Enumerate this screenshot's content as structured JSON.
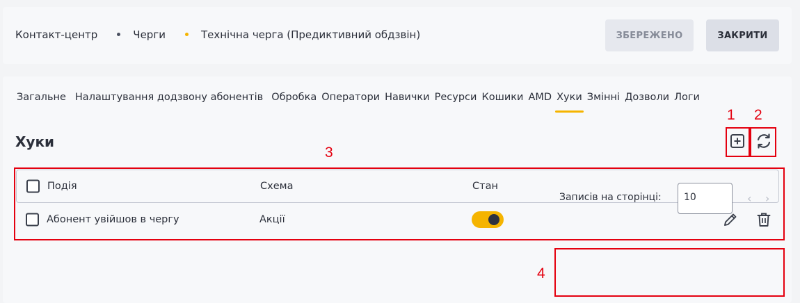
{
  "breadcrumb": [
    {
      "label": "Контакт-центр"
    },
    {
      "label": "Черги",
      "dot_color": "#4a5060"
    },
    {
      "label": "Технічна черга (Предиктивний обдзвін)",
      "dot_color": "#f5b400"
    }
  ],
  "header": {
    "saved_label": "ЗБЕРЕЖЕНО",
    "close_label": "ЗАКРИТИ"
  },
  "tabs": [
    {
      "label": "Загальне"
    },
    {
      "label": "Налаштування додзвону абонентів"
    },
    {
      "label": "Обробка"
    },
    {
      "label": "Оператори"
    },
    {
      "label": "Навички"
    },
    {
      "label": "Ресурси"
    },
    {
      "label": "Кошики"
    },
    {
      "label": "AMD"
    },
    {
      "label": "Хуки",
      "active": true
    },
    {
      "label": "Змінні"
    },
    {
      "label": "Дозволи"
    },
    {
      "label": "Логи"
    }
  ],
  "section": {
    "title": "Хуки",
    "add_icon": "plus-square-icon",
    "refresh_icon": "refresh-icon"
  },
  "table": {
    "columns": [
      "Подія",
      "Схема",
      "Стан"
    ],
    "rows": [
      {
        "event": "Абонент увійшов в чергу",
        "schema": "Акції",
        "enabled": true
      }
    ]
  },
  "pagination": {
    "label": "Записів на сторінці:",
    "per_page": "10"
  },
  "annotations": [
    "1",
    "2",
    "3",
    "4"
  ],
  "colors": {
    "accent": "#f5b400",
    "highlight": "#e4000f"
  }
}
